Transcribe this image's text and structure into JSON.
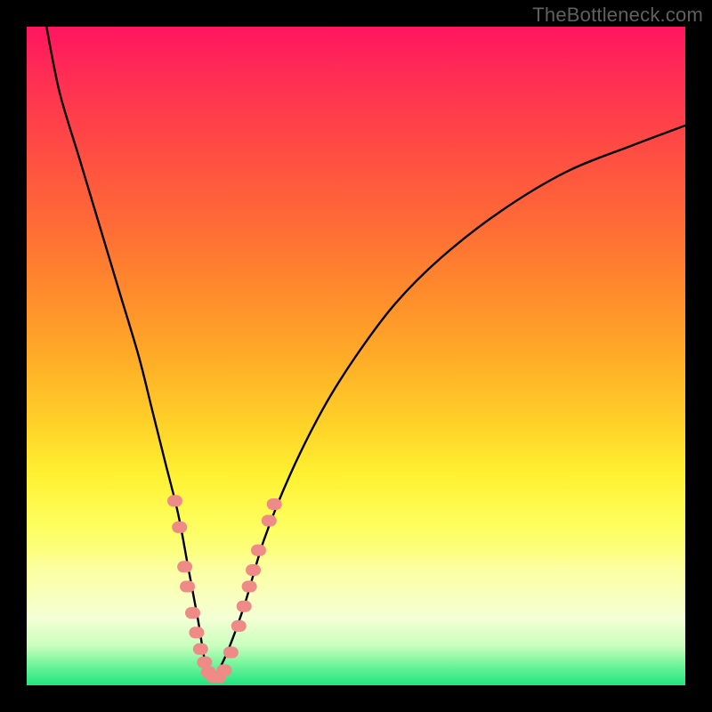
{
  "watermark": "TheBottleneck.com",
  "chart_data": {
    "type": "line",
    "title": "",
    "xlabel": "",
    "ylabel": "",
    "xlim": [
      0,
      100
    ],
    "ylim": [
      0,
      100
    ],
    "series": [
      {
        "name": "bottleneck-curve",
        "x": [
          3,
          5,
          8,
          11,
          14,
          17,
          19,
          21,
          23,
          24.5,
          26,
          27,
          28,
          30,
          33,
          36,
          40,
          45,
          50,
          56,
          63,
          72,
          82,
          92,
          100
        ],
        "y": [
          100,
          90,
          80,
          70,
          60,
          50,
          42,
          34,
          26,
          18,
          10,
          4,
          1,
          4,
          12,
          22,
          32,
          42,
          50,
          58,
          65,
          72,
          78,
          82,
          85
        ]
      }
    ],
    "markers": {
      "name": "highlight-points",
      "color": "#ee8b86",
      "points": [
        {
          "x": 22.5,
          "y": 28
        },
        {
          "x": 23.2,
          "y": 24
        },
        {
          "x": 24.0,
          "y": 18
        },
        {
          "x": 24.4,
          "y": 15
        },
        {
          "x": 25.2,
          "y": 11
        },
        {
          "x": 25.8,
          "y": 8
        },
        {
          "x": 26.4,
          "y": 5.5
        },
        {
          "x": 27.0,
          "y": 3.5
        },
        {
          "x": 27.6,
          "y": 2
        },
        {
          "x": 28.3,
          "y": 1.3
        },
        {
          "x": 29.1,
          "y": 1.2
        },
        {
          "x": 30.0,
          "y": 2.3
        },
        {
          "x": 31.0,
          "y": 5
        },
        {
          "x": 32.2,
          "y": 9
        },
        {
          "x": 33.0,
          "y": 12
        },
        {
          "x": 33.8,
          "y": 15
        },
        {
          "x": 34.4,
          "y": 17.5
        },
        {
          "x": 35.2,
          "y": 20.5
        },
        {
          "x": 36.8,
          "y": 25
        },
        {
          "x": 37.6,
          "y": 27.5
        }
      ]
    }
  }
}
